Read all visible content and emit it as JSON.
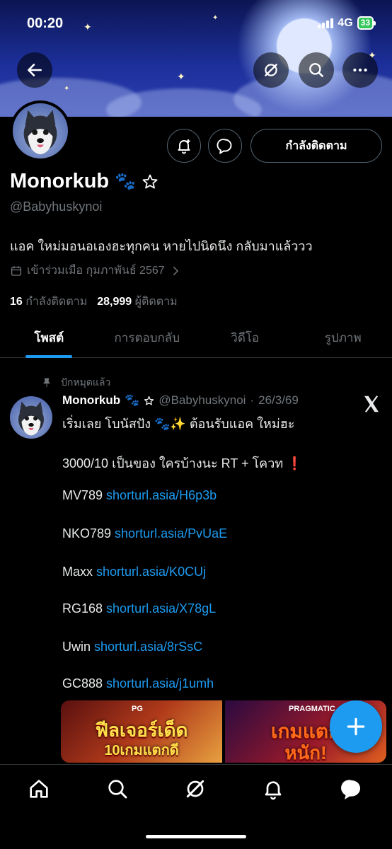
{
  "status_bar": {
    "time": "00:20",
    "network": "4G",
    "battery": "33"
  },
  "profile": {
    "name": "Monorkub",
    "name_emoji": "🐾",
    "handle": "@Babyhuskynoi",
    "bio": "แอค ใหม่มอนอเองฮะทุกคน หายไปนิดนึง กลับมาแล้ววว",
    "joined": "เข้าร่วมเมือ กุมภาพันธ์ 2567",
    "following_count": "16",
    "following_label": "กำลังติดตาม",
    "followers_count": "28,999",
    "followers_label": "ผู้ติดตาม",
    "follow_button_label": "กำลังติดตาม"
  },
  "tabs": [
    {
      "label": "โพสต์",
      "active": true
    },
    {
      "label": "การตอบกลับ",
      "active": false
    },
    {
      "label": "วิดีโอ",
      "active": false
    },
    {
      "label": "รูปภาพ",
      "active": false
    }
  ],
  "post": {
    "pinned_label": "ปักหมุดแล้ว",
    "author": "Monorkub",
    "author_emoji": "🐾",
    "handle": "@Babyhuskynoi",
    "date": "26/3/69",
    "lines": [
      {
        "text": "เริ่มเลย โบนัสปัง 🐾✨  ต้อนรับแอค ใหม่ฮะ",
        "link": ""
      },
      {
        "text": "3000/10 เป็นของ ใครบ้างนะ RT + โควท ❗",
        "link": ""
      },
      {
        "text": "MV789 ",
        "link": "shorturl.asia/H6p3b"
      },
      {
        "text": "NKO789 ",
        "link": "shorturl.asia/PvUaE"
      },
      {
        "text": "Maxx ",
        "link": "shorturl.asia/K0CUj"
      },
      {
        "text": "RG168 ",
        "link": "shorturl.asia/X78gL"
      },
      {
        "text": "Uwin ",
        "link": "shorturl.asia/8rSsC"
      },
      {
        "text": "GC888 ",
        "link": "shorturl.asia/j1umh"
      }
    ],
    "media": [
      {
        "badge": "PG",
        "title": "ฟีลเจอร์เด็ด",
        "subtitle": "10เกมแตกดี"
      },
      {
        "badge": "PRAGMATIC",
        "title": "เกมแตก",
        "subtitle": "หนัก!"
      }
    ]
  },
  "icons": {
    "back": "back-arrow-icon",
    "grok": "grok-icon",
    "search": "search-icon",
    "more": "more-icon",
    "notify": "bell-plus-icon",
    "message": "message-icon",
    "compose": "plus-icon"
  },
  "colors": {
    "accent": "#1d9bf0",
    "muted": "#71767b",
    "background": "#000000"
  }
}
